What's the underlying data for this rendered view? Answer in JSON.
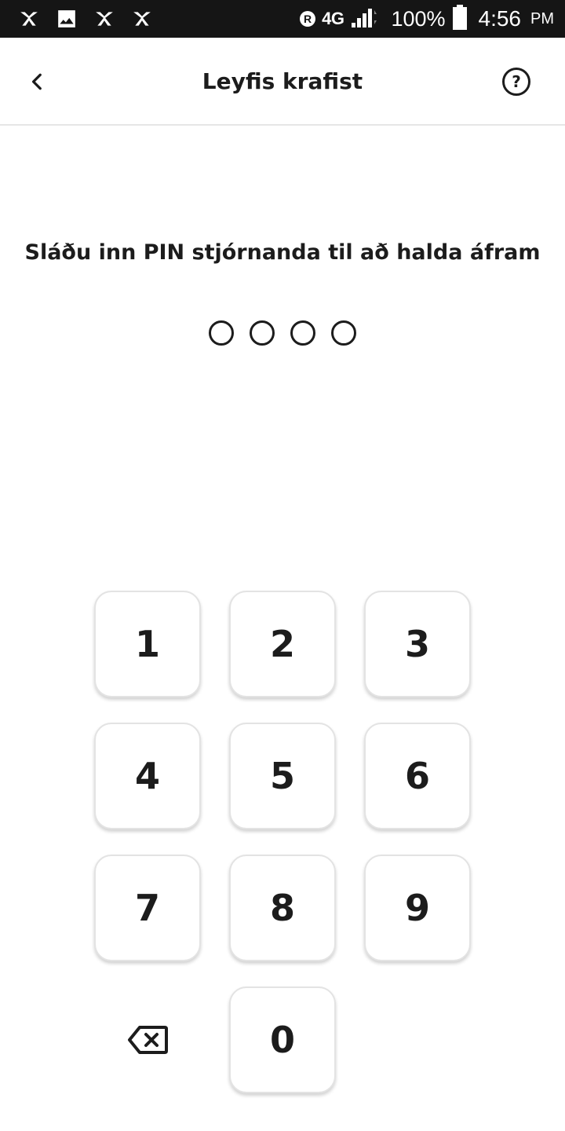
{
  "status_bar": {
    "left_icons": [
      "butterfly-icon",
      "image-icon",
      "butterfly-icon",
      "butterfly-icon"
    ],
    "roaming": "R",
    "network": "4G",
    "battery": "100%",
    "time": "4:56",
    "ampm": "PM"
  },
  "header": {
    "title": "Leyfis krafist",
    "help": "?"
  },
  "prompt": "Sláðu inn PIN stjórnanda til að halda áfram",
  "pin": {
    "length": 4,
    "entered": 0
  },
  "keypad": {
    "keys": [
      "1",
      "2",
      "3",
      "4",
      "5",
      "6",
      "7",
      "8",
      "9",
      "0"
    ],
    "delete_icon": "backspace-icon"
  },
  "colors": {
    "status_bar": "#151515",
    "text": "#1c1c1c",
    "key_border": "#e3e3e3"
  }
}
